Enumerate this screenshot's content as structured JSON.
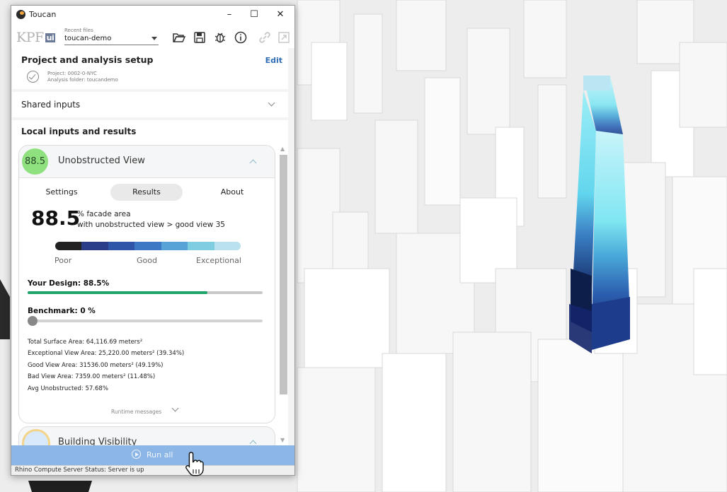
{
  "window": {
    "title": "Toucan"
  },
  "toolbar": {
    "logo_text": "KPF",
    "logo_badge": "ui",
    "recent_files_label": "Recent files",
    "recent_file_value": "toucan-demo",
    "icons": [
      "folder-open-icon",
      "save-icon",
      "bug-icon",
      "info-icon",
      "link-icon",
      "export-icon"
    ]
  },
  "project": {
    "heading": "Project and analysis setup",
    "edit_label": "Edit",
    "project_line": "Project: 0002-0-NYC",
    "folder_line": "Analysis folder: toucandemo"
  },
  "shared": {
    "heading": "Shared inputs"
  },
  "local": {
    "heading": "Local inputs and results"
  },
  "analysis": {
    "score": "88.5",
    "title": "Unobstructed View",
    "tabs": [
      "Settings",
      "Results",
      "About"
    ],
    "active_tab": "Results",
    "big_value": "88.5",
    "unit_line": "% facade area",
    "desc_line": "with unobstructed view > good view 35",
    "scale_labels": [
      "Poor",
      "Good",
      "Exceptional"
    ],
    "scale_colors": [
      "#222222",
      "#2a3d86",
      "#2f55a8",
      "#3d78c4",
      "#57a3d7",
      "#7fcde0",
      "#b9e2ee"
    ],
    "your_design_label": "Your Design: 88.5%",
    "your_design_fraction": 0.764,
    "benchmark_label": "Benchmark:   0  %",
    "benchmark_fraction": 0,
    "stats": [
      "Total Surface Area:  64,116.69 meters²",
      "Exceptional View Area:  25,220.00 meters² (39.34%)",
      "Good View Area:  31536.00 meters² (49.19%)",
      "Bad View Area:  7359.00 meters² (11.48%)",
      "Avg Unobstructed: 57.68%"
    ],
    "runtime_label": "Runtime messages"
  },
  "visibility": {
    "title": "Building Visibility"
  },
  "run": {
    "label": "Run all"
  },
  "status": {
    "text": "Rhino Compute Server Status:   Server is up"
  },
  "colors": {
    "accent": "#2f6db5",
    "progress": "#1ea56a",
    "score_bubble": "#8fe07f",
    "run_bar": "#8cb6e6"
  }
}
